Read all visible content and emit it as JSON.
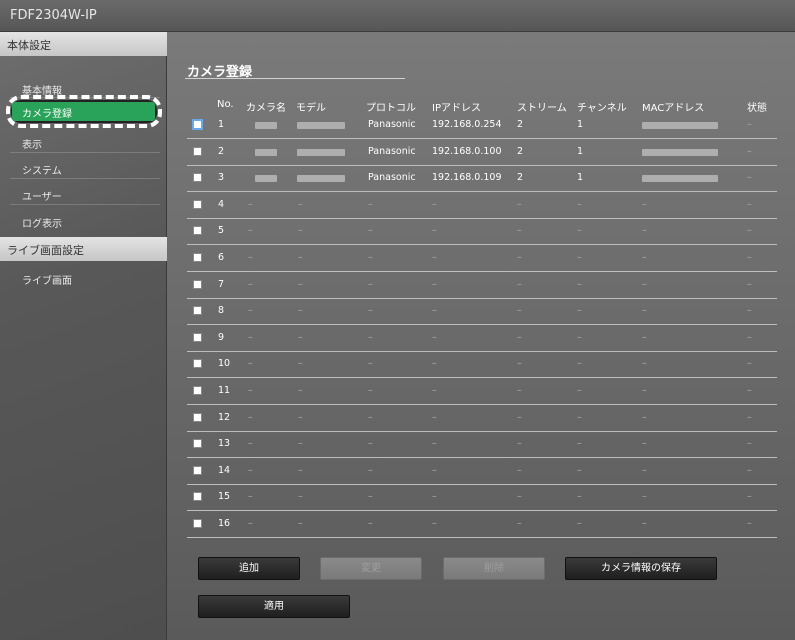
{
  "app": {
    "title": "FDF2304W-IP"
  },
  "sidebar": {
    "sections": [
      {
        "header": "本体設定",
        "items": [
          "基本情報",
          "カメラ登録",
          "表示",
          "システム",
          "ユーザー",
          "ログ表示"
        ],
        "active": "カメラ登録"
      },
      {
        "header": "ライブ画面設定",
        "items": [
          "ライブ画面"
        ]
      }
    ]
  },
  "main": {
    "title": "カメラ登録",
    "columns": [
      "No.",
      "カメラ名",
      "モデル",
      "プロトコル",
      "IPアドレス",
      "ストリーム",
      "チャンネル",
      "MACアドレス",
      "状態"
    ],
    "rows": [
      {
        "no": "1",
        "name": "",
        "model": "",
        "protocol": "Panasonic",
        "ip": "192.168.0.254",
        "stream": "2",
        "channel": "1",
        "mac": "",
        "status": "–"
      },
      {
        "no": "2",
        "name": "",
        "model": "",
        "protocol": "Panasonic",
        "ip": "192.168.0.100",
        "stream": "2",
        "channel": "1",
        "mac": "",
        "status": "–"
      },
      {
        "no": "3",
        "name": "",
        "model": "",
        "protocol": "Panasonic",
        "ip": "192.168.0.109",
        "stream": "2",
        "channel": "1",
        "mac": "",
        "status": "–"
      },
      {
        "no": "4",
        "name": "–",
        "model": "–",
        "protocol": "–",
        "ip": "–",
        "stream": "–",
        "channel": "–",
        "mac": "–",
        "status": "–"
      },
      {
        "no": "5",
        "name": "–",
        "model": "–",
        "protocol": "–",
        "ip": "–",
        "stream": "–",
        "channel": "–",
        "mac": "–",
        "status": "–"
      },
      {
        "no": "6",
        "name": "–",
        "model": "–",
        "protocol": "–",
        "ip": "–",
        "stream": "–",
        "channel": "–",
        "mac": "–",
        "status": "–"
      },
      {
        "no": "7",
        "name": "–",
        "model": "–",
        "protocol": "–",
        "ip": "–",
        "stream": "–",
        "channel": "–",
        "mac": "–",
        "status": "–"
      },
      {
        "no": "8",
        "name": "–",
        "model": "–",
        "protocol": "–",
        "ip": "–",
        "stream": "–",
        "channel": "–",
        "mac": "–",
        "status": "–"
      },
      {
        "no": "9",
        "name": "–",
        "model": "–",
        "protocol": "–",
        "ip": "–",
        "stream": "–",
        "channel": "–",
        "mac": "–",
        "status": "–"
      },
      {
        "no": "10",
        "name": "–",
        "model": "–",
        "protocol": "–",
        "ip": "–",
        "stream": "–",
        "channel": "–",
        "mac": "–",
        "status": "–"
      },
      {
        "no": "11",
        "name": "–",
        "model": "–",
        "protocol": "–",
        "ip": "–",
        "stream": "–",
        "channel": "–",
        "mac": "–",
        "status": "–"
      },
      {
        "no": "12",
        "name": "–",
        "model": "–",
        "protocol": "–",
        "ip": "–",
        "stream": "–",
        "channel": "–",
        "mac": "–",
        "status": "–"
      },
      {
        "no": "13",
        "name": "–",
        "model": "–",
        "protocol": "–",
        "ip": "–",
        "stream": "–",
        "channel": "–",
        "mac": "–",
        "status": "–"
      },
      {
        "no": "14",
        "name": "–",
        "model": "–",
        "protocol": "–",
        "ip": "–",
        "stream": "–",
        "channel": "–",
        "mac": "–",
        "status": "–"
      },
      {
        "no": "15",
        "name": "–",
        "model": "–",
        "protocol": "–",
        "ip": "–",
        "stream": "–",
        "channel": "–",
        "mac": "–",
        "status": "–"
      },
      {
        "no": "16",
        "name": "–",
        "model": "–",
        "protocol": "–",
        "ip": "–",
        "stream": "–",
        "channel": "–",
        "mac": "–",
        "status": "–"
      }
    ],
    "buttons": {
      "add": "追加",
      "modify": "変更",
      "delete": "削除",
      "save_camera_info": "カメラ情報の保存",
      "apply": "適用"
    }
  },
  "colors": {
    "active_item": "#2aa35a",
    "focus_border": "#6aa8e8"
  }
}
